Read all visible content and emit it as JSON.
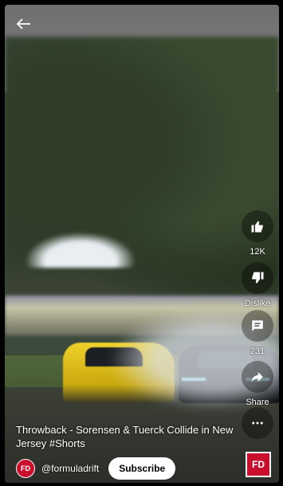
{
  "icons": {
    "back": "arrow-left-icon",
    "like": "thumbs-up-icon",
    "dislike": "thumbs-down-icon",
    "comments": "comment-icon",
    "share": "share-icon",
    "more": "more-icon"
  },
  "actions": {
    "like_count": "12K",
    "dislike_label": "Dislike",
    "comment_count": "231",
    "share_label": "Share"
  },
  "video": {
    "title": "Throwback - Sorensen & Tuerck Collide in New Jersey #Shorts"
  },
  "channel": {
    "avatar_text": "FD",
    "handle": "@formuladrift",
    "subscribe_label": "Subscribe",
    "logo_text": "FD"
  },
  "colors": {
    "brand_red": "#c8102e",
    "subscribe_bg": "#ffffff"
  }
}
